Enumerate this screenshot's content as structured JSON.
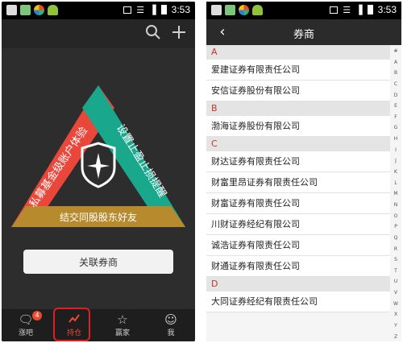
{
  "status_bar": {
    "time": "3:53"
  },
  "left_screen": {
    "triangle": {
      "left_side_text": "私募基金级账户体验",
      "right_side_text": "设置止盈止损提醒",
      "bottom_side_text": "结交同股股东好友",
      "colors": {
        "left": "#e8473a",
        "right": "#1aa88d",
        "bottom": "#b88a2e",
        "shield": "#ffffff"
      }
    },
    "link_button_label": "关联券商",
    "nav": [
      {
        "label": "涨吧",
        "icon": "chat-icon",
        "badge": "4"
      },
      {
        "label": "持仓",
        "icon": "chart-icon",
        "active": true
      },
      {
        "label": "赢家",
        "icon": "star-icon"
      },
      {
        "label": "我",
        "icon": "person-icon"
      }
    ]
  },
  "right_screen": {
    "title": "券商",
    "sections": [
      {
        "letter": "A",
        "items": [
          "爱建证券有限责任公司",
          "安信证券股份有限公司"
        ]
      },
      {
        "letter": "B",
        "items": [
          "渤海证券股份有限公司"
        ]
      },
      {
        "letter": "C",
        "items": [
          "财达证券有限责任公司",
          "财富里昂证券有限责任公司",
          "财富证券有限责任公司",
          "川财证券经纪有限公司",
          "诚浩证券有限责任公司",
          "财通证券有限责任公司"
        ]
      },
      {
        "letter": "D",
        "items": [
          "大同证券经纪有限责任公司"
        ]
      }
    ],
    "index_letters": [
      "#",
      "A",
      "B",
      "C",
      "D",
      "E",
      "F",
      "G",
      "H",
      "I",
      "J",
      "K",
      "L",
      "M",
      "N",
      "O",
      "P",
      "Q",
      "R",
      "S",
      "T",
      "U",
      "V",
      "W",
      "X",
      "Y",
      "Z"
    ]
  }
}
